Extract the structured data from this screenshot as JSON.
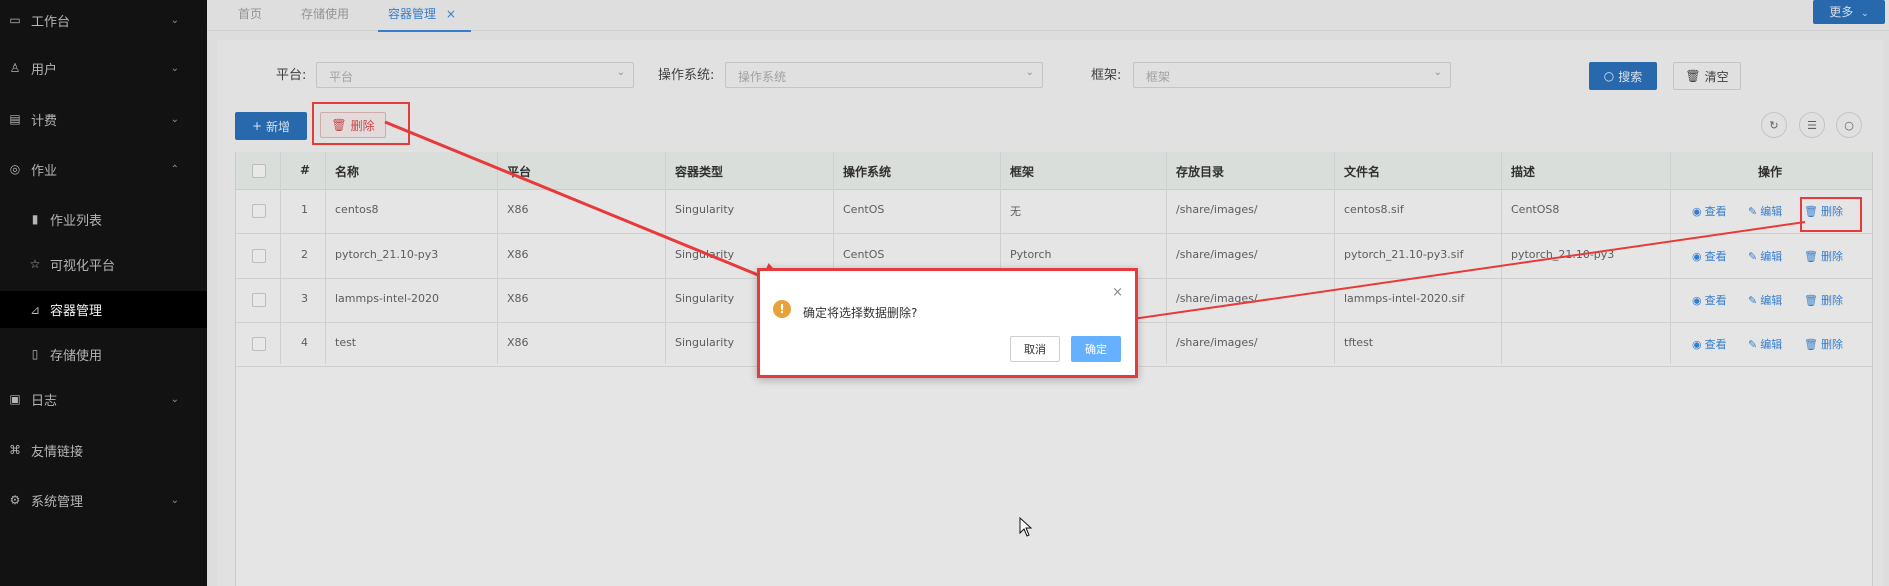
{
  "sidebar": {
    "items": [
      {
        "label": "工作台",
        "icon": "monitor-icon",
        "chev": "⌄"
      },
      {
        "label": "用户",
        "icon": "user-icon",
        "chev": "⌄"
      },
      {
        "label": "计费",
        "icon": "billing-icon",
        "chev": "⌄"
      },
      {
        "label": "作业",
        "icon": "job-icon",
        "chev": "⌃"
      },
      {
        "label": "作业列表",
        "icon": "bar-chart-icon"
      },
      {
        "label": "可视化平台",
        "icon": "star-icon"
      },
      {
        "label": "容器管理",
        "icon": "container-icon"
      },
      {
        "label": "存储使用",
        "icon": "storage-icon"
      },
      {
        "label": "日志",
        "icon": "log-icon",
        "chev": "⌄"
      },
      {
        "label": "友情链接",
        "icon": "link-icon"
      },
      {
        "label": "系统管理",
        "icon": "gear-icon",
        "chev": "⌄"
      }
    ]
  },
  "tabs": [
    {
      "label": "首页"
    },
    {
      "label": "存储使用"
    },
    {
      "label": "容器管理",
      "close": "×"
    }
  ],
  "more_button": "更多",
  "filters": {
    "platform_label": "平台:",
    "platform_placeholder": "平台",
    "os_label": "操作系统:",
    "os_placeholder": "操作系统",
    "framework_label": "框架:",
    "framework_placeholder": "框架",
    "search": "搜索",
    "clear": "清空"
  },
  "toolbar": {
    "add": "新增",
    "delete": "删除"
  },
  "table": {
    "columns": [
      "#",
      "名称",
      "平台",
      "容器类型",
      "操作系统",
      "框架",
      "存放目录",
      "文件名",
      "描述",
      "操作"
    ],
    "rows": [
      {
        "no": "1",
        "name": "centos8",
        "platform": "X86",
        "type": "Singularity",
        "os": "CentOS",
        "framework": "无",
        "dir": "/share/images/",
        "file": "centos8.sif",
        "desc": "CentOS8"
      },
      {
        "no": "2",
        "name": "pytorch_21.10-py3",
        "platform": "X86",
        "type": "Singularity",
        "os": "CentOS",
        "framework": "Pytorch",
        "dir": "/share/images/",
        "file": "pytorch_21.10-py3.sif",
        "desc": "pytorch_21.10-py3"
      },
      {
        "no": "3",
        "name": "lammps-intel-2020",
        "platform": "X86",
        "type": "Singularity",
        "os": "",
        "framework": "",
        "dir": "/share/images/",
        "file": "lammps-intel-2020.sif",
        "desc": ""
      },
      {
        "no": "4",
        "name": "test",
        "platform": "X86",
        "type": "Singularity",
        "os": "",
        "framework": "",
        "dir": "/share/images/",
        "file": "tftest",
        "desc": ""
      }
    ],
    "actions": {
      "view": "查看",
      "edit": "编辑",
      "delete": "删除"
    }
  },
  "dialog": {
    "message": "确定将选择数据删除?",
    "cancel": "取消",
    "confirm": "确定",
    "close": "×",
    "icon": "!"
  },
  "colors": {
    "accent": "#2b6fb8",
    "danger": "#e83a3a",
    "warning": "#e8a23a"
  }
}
